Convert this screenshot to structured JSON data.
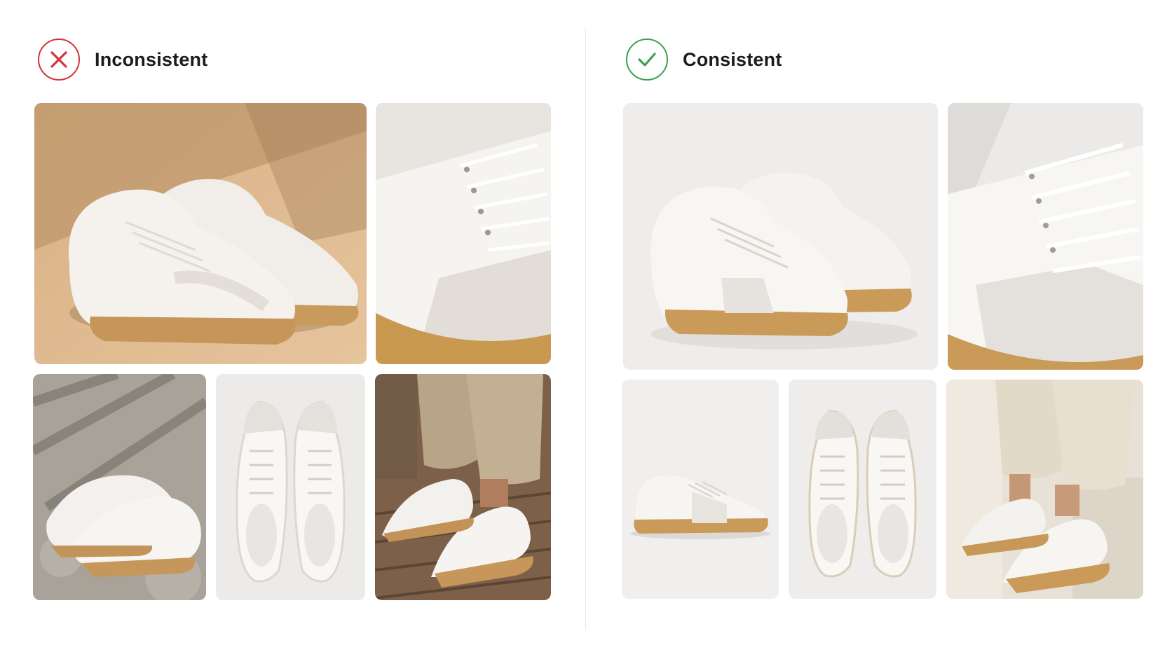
{
  "panels": [
    {
      "title": "Inconsistent",
      "status": "x-icon",
      "status_color": "#d4343a",
      "photos": [
        {
          "scene": "sneaker-pair-sunlit-beige-floor-photo",
          "bg": "#d9b38c"
        },
        {
          "scene": "sneaker-closeup-laces-photo",
          "bg": "#dcd8d2"
        },
        {
          "scene": "sneaker-pair-stone-pavement-photo",
          "bg": "#a9a49c"
        },
        {
          "scene": "sneaker-pair-top-view-photo",
          "bg": "#ececea"
        },
        {
          "scene": "sneakers-worn-wood-deck-photo",
          "bg": "#7a5e48"
        }
      ]
    },
    {
      "title": "Consistent",
      "status": "check-icon",
      "status_color": "#3aa34f",
      "photos": [
        {
          "scene": "sneaker-pair-studio-angle-photo",
          "bg": "#eeedeb"
        },
        {
          "scene": "sneaker-closeup-studio-photo",
          "bg": "#ebeae8"
        },
        {
          "scene": "sneaker-side-view-studio-photo",
          "bg": "#f0efed"
        },
        {
          "scene": "sneaker-pair-top-view-studio-photo",
          "bg": "#eeedeb"
        },
        {
          "scene": "sneakers-worn-studio-steps-photo",
          "bg": "#e6e0d6"
        }
      ]
    }
  ]
}
